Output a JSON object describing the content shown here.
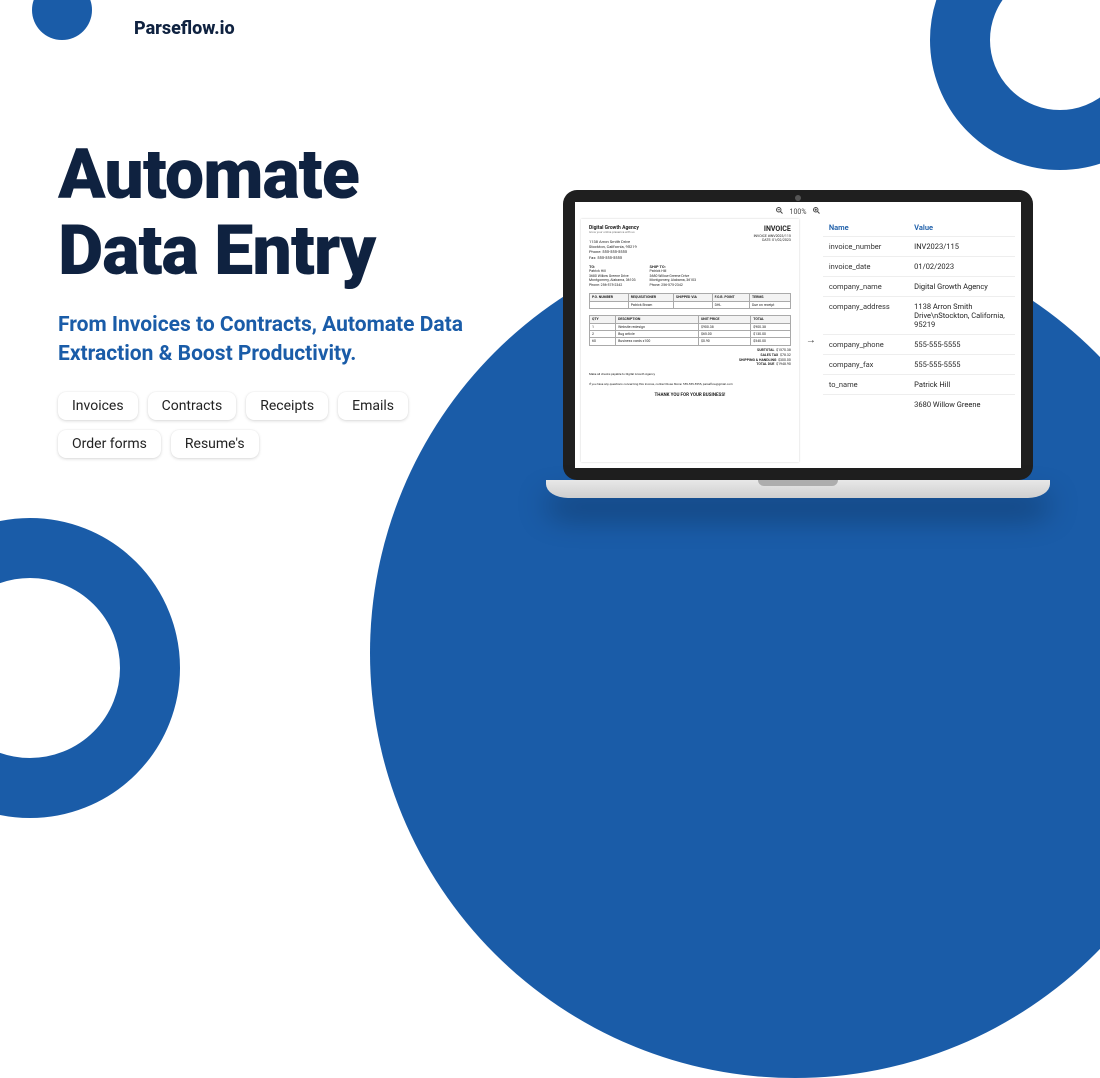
{
  "brand": "Parseflow.io",
  "hero": {
    "title_line1": "Automate",
    "title_line2": "Data Entry",
    "subtitle": "From Invoices to Contracts, Automate Data Extraction & Boost Productivity."
  },
  "chips": [
    "Invoices",
    "Contracts",
    "Receipts",
    "Emails",
    "Order forms",
    "Resume's"
  ],
  "toolbar": {
    "zoom": "100%"
  },
  "invoice": {
    "company": "Digital Growth Agency",
    "company_tagline": "Grow your online presence with us",
    "company_addr": [
      "1138 Arron Smith Drive",
      "Stockton, California, 95219",
      "Phone: 555-555-5555",
      "Fax: 555-555-5555"
    ],
    "label": "INVOICE",
    "meta_no": "INVOICE #INV2023/115",
    "meta_date": "DATE: 01/02/2023",
    "to_label": "TO:",
    "to": [
      "Patrick Hill",
      "3680 Willow Greene Drive",
      "Montgomery, Alabama, 36103",
      "Phone: 256-575-2342"
    ],
    "ship_label": "SHIP TO:",
    "ship": [
      "Patrick Hill",
      "3680 Willow Greene Drive",
      "Montgomery, Alabama, 36103",
      "Phone: 256-575-2342"
    ],
    "head1": [
      "P.O. NUMBER",
      "REQUISITIONER",
      "SHIPPED VIA",
      "F.O.B. POINT",
      "TERMS"
    ],
    "row1": [
      "",
      "Patrick Brown",
      "",
      "DHL",
      "Due on receipt"
    ],
    "head2": [
      "QTY",
      "DESCRIPTION",
      "UNIT PRICE",
      "TOTAL"
    ],
    "items": [
      [
        "1",
        "Website redesign",
        "$900.38",
        "$900.38"
      ],
      [
        "2",
        "Bug article",
        "$65.00",
        "$130.00"
      ],
      [
        "60",
        "Business cards x100",
        "$0.90",
        "$540.00"
      ]
    ],
    "subtotal_label": "SUBTOTAL",
    "subtotal": "$1570.38",
    "tax_label": "SALES TAX",
    "tax": "$78.32",
    "ship_cost_label": "SHIPPING & HANDLING",
    "ship_cost": "$300.00",
    "total_label": "TOTAL DUE",
    "total": "$1948.90",
    "fineprint1": "Make all checks payable to Digital Growth Agency",
    "fineprint2": "If you have any questions concerning this invoice, contact Rose Stone: 555-555-5555, parseflow@gmail.com",
    "thanks": "THANK YOU FOR YOUR BUSINESS!"
  },
  "extract": {
    "headers": {
      "name": "Name",
      "value": "Value"
    },
    "rows": [
      {
        "k": "invoice_number",
        "v": "INV2023/115"
      },
      {
        "k": "invoice_date",
        "v": "01/02/2023"
      },
      {
        "k": "company_name",
        "v": "Digital Growth Agency"
      },
      {
        "k": "company_address",
        "v": "1138 Arron Smith Drive\\nStockton, California, 95219"
      },
      {
        "k": "company_phone",
        "v": "555-555-5555"
      },
      {
        "k": "company_fax",
        "v": "555-555-5555"
      },
      {
        "k": "to_name",
        "v": "Patrick Hill"
      },
      {
        "k": "",
        "v": "3680 Willow Greene"
      }
    ]
  }
}
